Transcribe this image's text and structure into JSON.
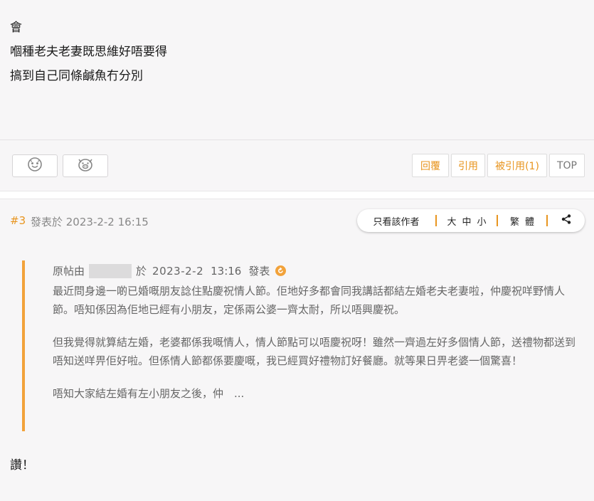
{
  "post1": {
    "lines": [
      "會",
      "嗰種老夫老妻既思維好唔要得",
      "搞到自己同條鹹魚冇分別"
    ],
    "reactions": [
      {
        "icon": "smile-face-icon"
      },
      {
        "icon": "pig-face-icon"
      }
    ],
    "buttons": {
      "reply": "回覆",
      "quote": "引用",
      "quoted": "被引用(1)",
      "top": "TOP"
    }
  },
  "post2": {
    "number": "#3",
    "posted": "發表於 2023-2-2 16:15",
    "toolbar": {
      "only_author": "只看該作者",
      "size_large": "大",
      "size_medium": "中",
      "size_small": "小",
      "trad": "繁",
      "simp": "體",
      "share_icon": "share-icon"
    },
    "quote": {
      "prefix": "原帖由",
      "at": "於",
      "date": "2023-2-2",
      "time": "13:16",
      "suffix": "發表",
      "paragraphs": [
        "最近問身邊一啲已婚嘅朋友諗住點慶祝情人節。佢地好多都會同我講話都結左婚老夫老妻啦，仲慶祝咩野情人節。唔知係因為佢地已經有小朋友，定係兩公婆一齊太耐，所以唔興慶祝。",
        "但我覺得就算結左婚，老婆都係我嘅情人，情人節點可以唔慶祝呀！雖然一齊過左好多個情人節，送禮物都送到唔知送咩畀佢好啦。但係情人節都係要慶嘅，我已經買好禮物訂好餐廳。就等果日畀老婆一個驚喜！",
        "唔知大家結左婚有左小朋友之後，仲　..."
      ]
    },
    "reply": "讚！"
  }
}
